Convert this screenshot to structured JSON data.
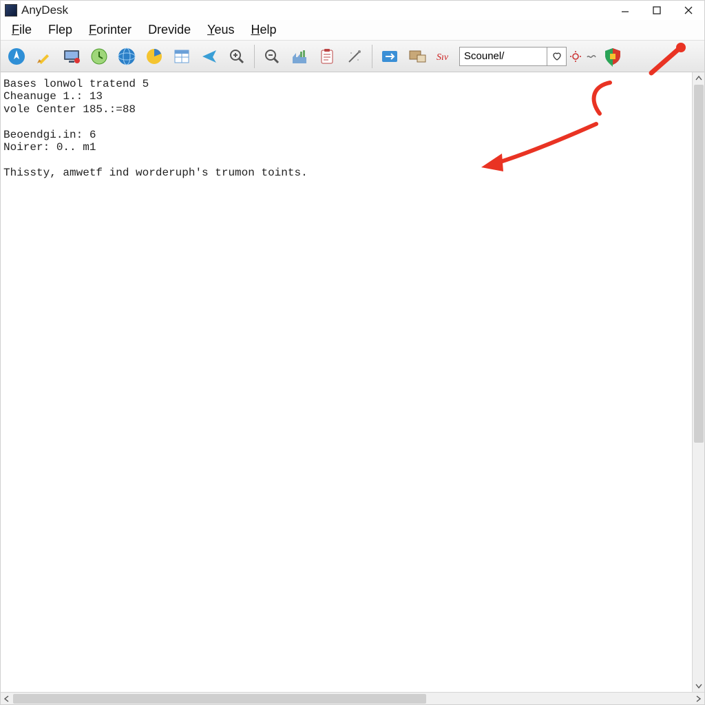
{
  "title": "AnyDesk",
  "menu": {
    "file": "File",
    "flep": "Flep",
    "forinter": "Forinter",
    "drevide": "Drevide",
    "yeus": "Yeus",
    "help": "Help"
  },
  "toolbar_icons": [
    "compass-icon",
    "pencil-icon",
    "monitor-icon",
    "clock-refresh-icon",
    "globe-icon",
    "pie-chart-icon",
    "table-icon",
    "send-icon",
    "zoom-in-icon",
    "zoom-out-icon",
    "factory-icon",
    "clipboard-icon",
    "wand-icon",
    "arrows-icon",
    "devices-icon",
    "signature-icon"
  ],
  "small_icons": {
    "gear": "gear-icon",
    "tilde": "tilde-icon"
  },
  "search": {
    "value": "Scounel/"
  },
  "shield_icon": "shield-icon",
  "content_lines": [
    "Bases lonwol tratend 5",
    "Cheanuge 1.: 13",
    "vole Center 185.:=88",
    "",
    "Beoendgi.in: 6",
    "Noirer: 0.. m1",
    "",
    "Thissty, amwetf ind worderuph's trumon toints."
  ]
}
